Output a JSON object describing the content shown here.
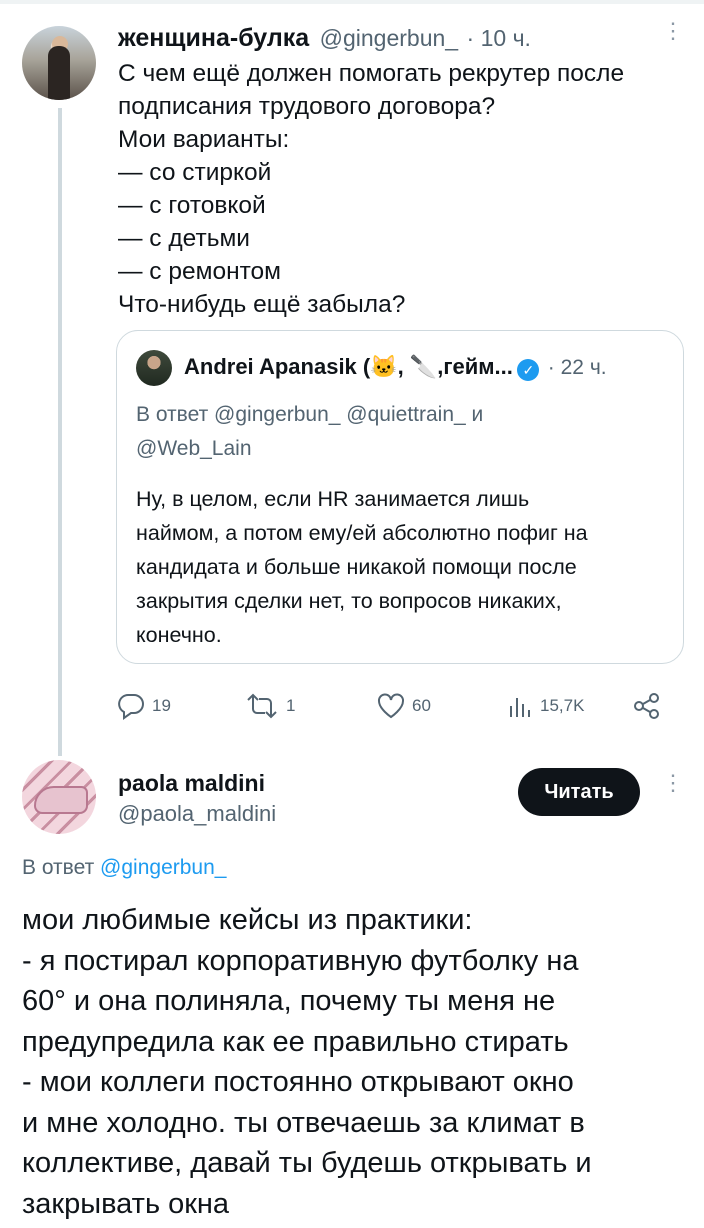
{
  "tweet": {
    "author_name": "женщина-булка",
    "author_handle": "@gingerbun_",
    "time": "· 10 ч.",
    "more_icon": "more-vertical-icon",
    "text": "С чем ещё должен помогать рекрутер после\nподписания трудового договора?\nМои варианты:\n— со стиркой\n— с готовкой\n— с детьми\n— с ремонтом\nЧто-нибудь ещё забыла?"
  },
  "quote": {
    "author_name": "Andrei Apanasik (🐱, 🔪,гейм...",
    "verified_icon": "verified-badge-icon",
    "time": "· 22 ч.",
    "reply_prefix": "В ответ",
    "reply_to_line1": "@gingerbun_ @quiettrain_ и",
    "reply_to_line2": "@Web_Lain",
    "text": "Ну, в целом, если HR занимается лишь\nнаймом, а потом ему/ей абсолютно пофиг на\nкандидата и больше никакой помощи после\nзакрытия сделки нет, то вопросов никаких,\nконечно."
  },
  "actions": {
    "replies": "19",
    "retweets": "1",
    "likes": "60",
    "views": "15,7K"
  },
  "reply": {
    "author_name": "paola maldini",
    "author_handle": "@paola_maldini",
    "follow_label": "Читать",
    "reply_prefix": "В ответ",
    "reply_to": "@gingerbun_",
    "text": "мои любимые кейсы из практики:\n- я постирал корпоративную футболку на\n60° и она полиняла, почему ты меня не\nпредупредила как ее правильно стирать\n- мои коллеги постоянно открывают окно\nи мне холодно. ты отвечаешь за климат в\nколлективе, давай ты будешь открывать и\nзакрывать окна"
  }
}
